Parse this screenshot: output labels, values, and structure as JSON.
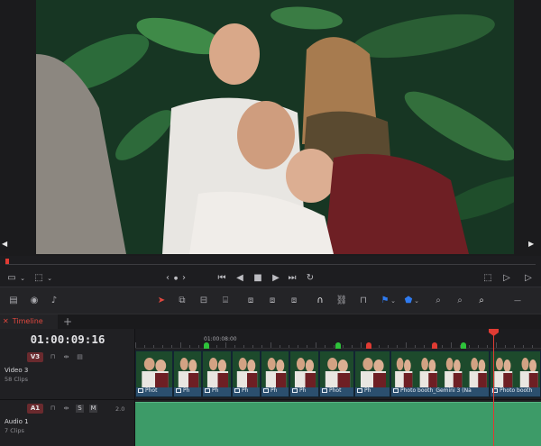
{
  "timeline": {
    "tab_close": "✕",
    "tab_name": "Timeline 1",
    "tab_chevron": "⌄",
    "add_tab": "+",
    "timecode": "01:00:09:16",
    "ruler_label": "01:00:08:00"
  },
  "tracks": {
    "video": {
      "badge": "V3",
      "name": "Video 3",
      "count": "58 Clips"
    },
    "audio": {
      "badge": "A1",
      "name": "Audio 1",
      "count": "7 Clips",
      "level": "2.0",
      "solo": "S",
      "mute": "M"
    }
  },
  "clips": [
    {
      "label": "Phot"
    },
    {
      "label": "Ph"
    },
    {
      "label": "Ph"
    },
    {
      "label": "Ph"
    },
    {
      "label": "Ph"
    },
    {
      "label": "Ph"
    },
    {
      "label": "Phot"
    },
    {
      "label": "Ph"
    },
    {
      "label": "Photo booth_Gemini 3 (Na"
    },
    {
      "label": "Photo booth"
    }
  ],
  "transport": {
    "nav_left": "‹",
    "nav_dot": "●",
    "nav_right": "›"
  },
  "colors": {
    "accent_red": "#e03b33",
    "clip_blue": "#2b4f6e",
    "audio_green": "#3d9b68",
    "marker_green": "#2ec23a",
    "marker_red": "#e03b33",
    "flag_blue": "#2f7bf0"
  },
  "icons": [
    "viewer-layout-icon",
    "transform-icon",
    "skip-to-start-icon",
    "step-back-icon",
    "stop-icon",
    "play-icon",
    "skip-to-end-icon",
    "loop-icon",
    "fullscreen-icon",
    "select-tool-icon",
    "trim-tool-icon",
    "blade-tool-icon",
    "snap-icon",
    "link-icon",
    "lock-icon",
    "flag-icon",
    "marker-icon",
    "zoom-icon"
  ]
}
